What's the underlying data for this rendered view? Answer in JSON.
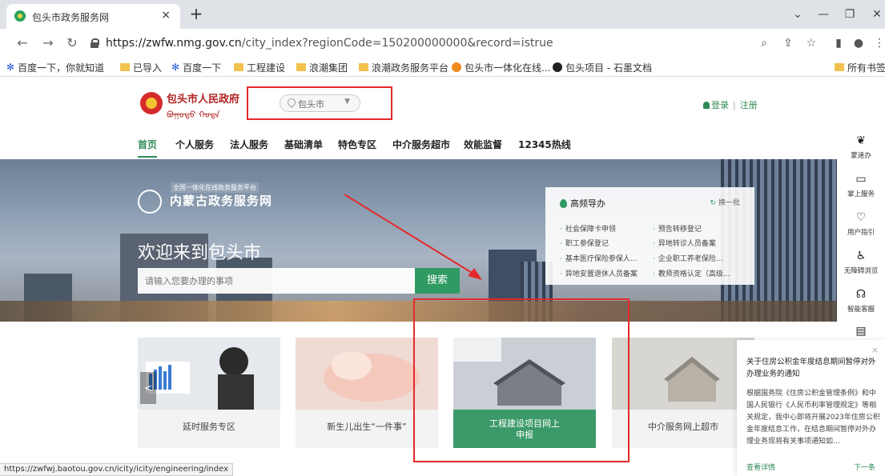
{
  "browser": {
    "tab_title": "包头市政务服务网",
    "tab_close": "×",
    "new_tab": "+",
    "url_host": "https://zwfw.nmg.gov.cn",
    "url_path": "/city_index?regionCode=150200000000&record=istrue",
    "bookmarks": [
      "百度一下，你就知道",
      "已导入",
      "百度一下",
      "工程建设",
      "浪潮集团",
      "浪潮政务服务平台",
      "包头市一体化在线...",
      "包头项目 - 石墨文档",
      "所有书签"
    ],
    "status_url": "https://zwfwj.baotou.gov.cn/icity/icity/engineering/index"
  },
  "header": {
    "logo_name": "包头市人民政府",
    "logo_script": "ᠪᠣᠭᠣᠲᠣ ᠬᠣᠲᠠ",
    "city": "包头市",
    "login": "登录",
    "register": "注册",
    "sep": "|"
  },
  "nav": [
    "首页",
    "个人服务",
    "法人服务",
    "基础清单",
    "特色专区",
    "中介服务超市",
    "效能监督",
    "12345热线"
  ],
  "hero": {
    "sub_badge": "全国一体化在线政务服务平台",
    "brand": "内蒙古政务服务网",
    "welcome": "欢迎来到包头市",
    "search_placeholder": "请输入您要办理的事项",
    "search_button": "搜索"
  },
  "frequent": {
    "title": "高频导办",
    "refresh": "换一批",
    "items": [
      "社会保障卡申领",
      "预告转移登记",
      "职工参保登记",
      "异地转诊人员备案",
      "基本医疗保险参保人...",
      "企业职工养老保险...",
      "异地安置退休人员备案",
      "教师资格认定（高级..."
    ]
  },
  "cards": [
    {
      "label": "延时服务专区"
    },
    {
      "label": "新生儿出生“一件事”"
    },
    {
      "label": "工程建设项目网上申报"
    },
    {
      "label": "中介服务网上超市"
    }
  ],
  "carousel_prev": "<",
  "side_tools": [
    "蒙速办",
    "掌上服务",
    "用户指引",
    "无障碍浏览",
    "智能客服",
    ""
  ],
  "notice": {
    "title": "关于住房公积金年度结息期间暂停对外办理业务的通知",
    "body": "根据国务院《住房公积金管理条例》和中国人民银行《人民币利率管理规定》等相关规定，我中心即将开展2023年住房公积金年度结息工作，在结息期间暂停对外办理业务现将有关事项通知如...",
    "more": "查看详情",
    "next": "下一条",
    "close": "×"
  },
  "colors": {
    "accent": "#2e8b57",
    "highlight": "#e5292b"
  }
}
